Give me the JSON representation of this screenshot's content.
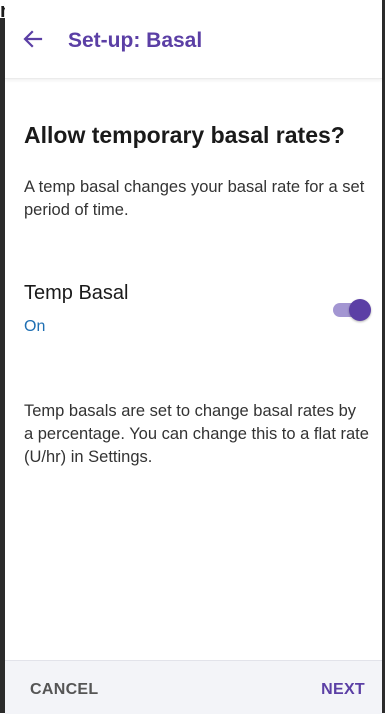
{
  "header": {
    "title": "Set-up: Basal",
    "back_icon": "arrow-left-icon"
  },
  "main": {
    "heading": "Allow temporary basal rates?",
    "description": "A temp basal changes your basal rate for a set period of time.",
    "toggle": {
      "label": "Temp Basal",
      "state_text": "On",
      "on": true
    },
    "note": "Temp basals are set to change basal rates by a percentage. You can change this to a flat rate (U/hr) in Settings."
  },
  "footer": {
    "cancel_label": "CANCEL",
    "next_label": "NEXT"
  },
  "colors": {
    "accent": "#5b3fa5",
    "accent_light": "#a396d2",
    "status_blue": "#1f6fb3",
    "footer_bg": "#f3f4f8"
  }
}
